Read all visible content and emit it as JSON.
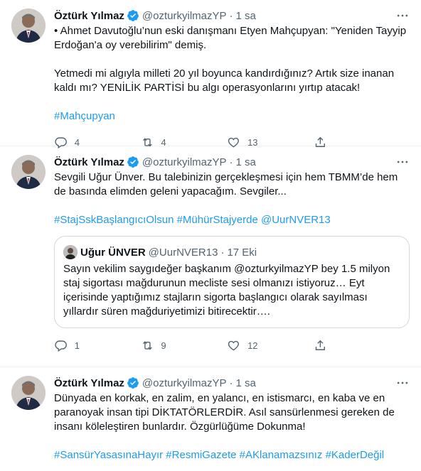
{
  "tweets": [
    {
      "name": "Öztürk Yılmaz",
      "handle": "@ozturkyilmazYP",
      "time": "1 sa",
      "lines": [
        "• Ahmet Davutoğlu’nun eski danışmanı Etyen Mahçupyan: \"Yeniden Tayyip Erdoğan'a oy verebilirim\" demiş.",
        "Yetmedi mi algıyla milleti 20 yıl boyunca kandırdığınız? Artık size inanan kaldı mı? YENİLİK PARTİSİ bu algı operasyonlarını yırtıp atacak!"
      ],
      "hashtags": "#Mahçupyan",
      "replies": "4",
      "retweets": "4",
      "likes": "13"
    },
    {
      "name": "Öztürk Yılmaz",
      "handle": "@ozturkyilmazYP",
      "time": "1 sa",
      "lines": [
        "Sevgili Uğur Ünver. Bu talebinizin gerçekleşmesi için hem TBMM’de hem de basında elimden geleni yapacağım. Sevgiler..."
      ],
      "hashtags": "#StajSskBaşlangıcıOlsun #MühürStajyerde @UurNVER13",
      "quote": {
        "name": "Uğur ÜNVER",
        "handle": "@UurNVER13",
        "time": "17 Eki",
        "text": "Sayın vekilim saygıdeğer başkanım @ozturkyilmazYP bey 1.5 milyon staj sigortası mağdurunun mecliste sesi olmanızı istiyoruz… Eyt içerisinde yaptığımız stajların sigorta başlangıcı olarak sayılması yıllardır süren mağduriyetimizi bitirecektir…."
      },
      "replies": "1",
      "retweets": "9",
      "likes": "12"
    },
    {
      "name": "Öztürk Yılmaz",
      "handle": "@ozturkyilmazYP",
      "time": "1 sa",
      "lines": [
        "Dünyada en korkak, en zalim, en yalancı, en istismarcı, en kaba ve en paranoyak insan tipi DİKTATÖRLERDİR. Asıl sansürlenmesi gereken de insanı köleleştiren bunlardır. Özgürlüğüme Dokunma!"
      ],
      "hashtags": "#SansürYasasınaHayır #ResmiGazete #AKlanamazsınız #KaderDeğil"
    }
  ],
  "colors": {
    "accent": "#1d9bf0",
    "text": "#0f1419",
    "muted": "#536471",
    "border": "#eff3f4"
  }
}
